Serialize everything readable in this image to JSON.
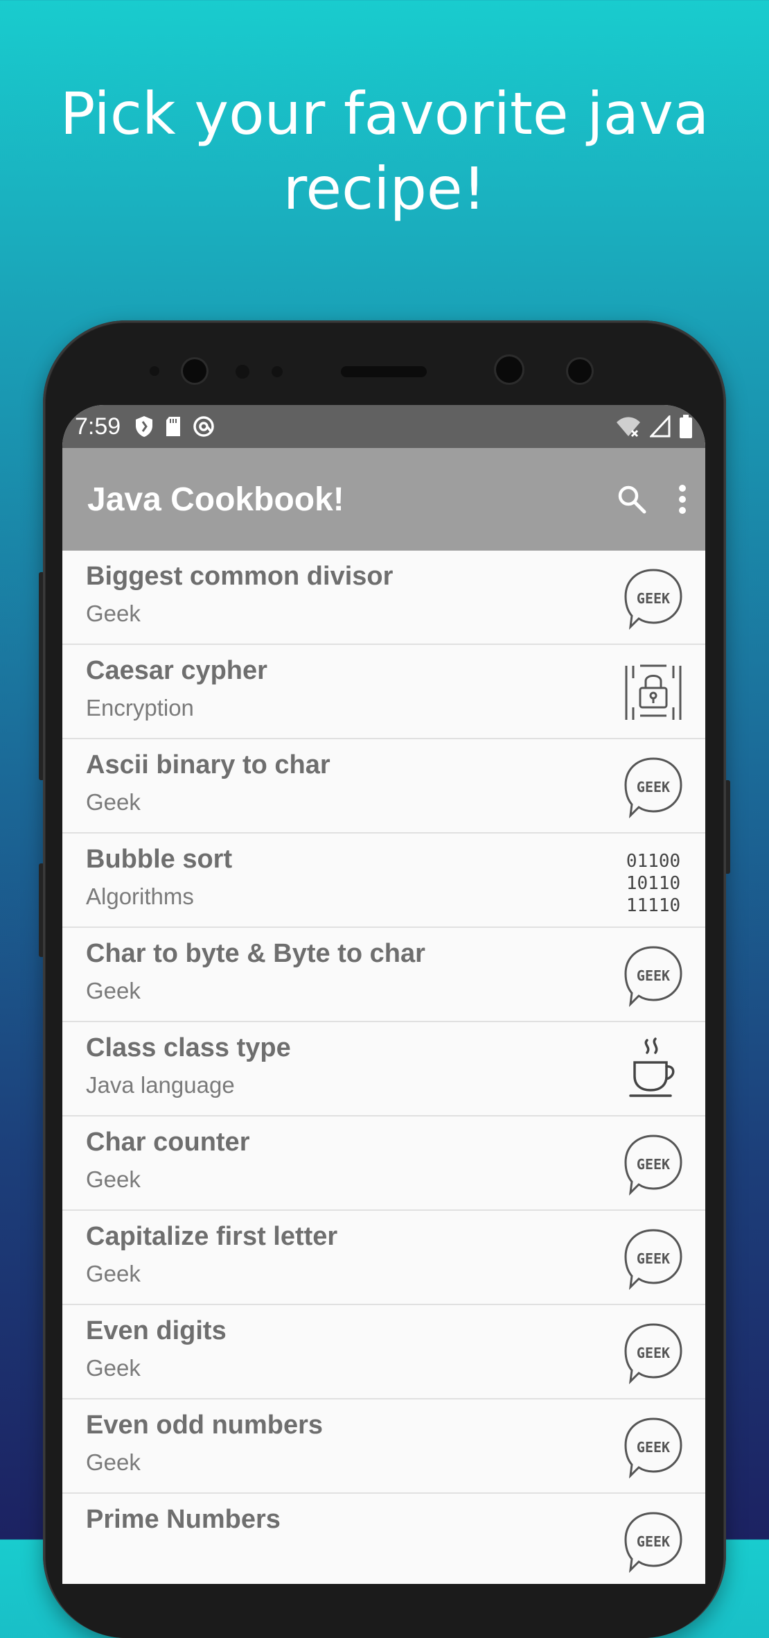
{
  "headline": {
    "line1": "Pick your favorite java",
    "line2": "recipe!"
  },
  "status_bar": {
    "time": "7:59",
    "left_icons": [
      "shield-icon",
      "sd-card-icon",
      "at-sign-icon"
    ],
    "right_icons": [
      "wifi-off-icon",
      "signal-icon",
      "battery-icon"
    ]
  },
  "app_bar": {
    "title": "Java Cookbook!",
    "actions": [
      "search-icon",
      "more-vert-icon"
    ],
    "background": "#9e9e9e"
  },
  "recipes": [
    {
      "title": "Biggest common divisor",
      "category": "Geek",
      "icon": "geek-bubble-icon"
    },
    {
      "title": "Caesar cypher",
      "category": "Encryption",
      "icon": "binary-lock-icon"
    },
    {
      "title": "Ascii binary to char",
      "category": "Geek",
      "icon": "geek-bubble-icon"
    },
    {
      "title": "Bubble sort",
      "category": "Algorithms",
      "icon": "binary-digits-icon",
      "icon_text": [
        "01100",
        "10110",
        "11110"
      ]
    },
    {
      "title": "Char to byte & Byte to char",
      "category": "Geek",
      "icon": "geek-bubble-icon"
    },
    {
      "title": "Class class type",
      "category": "Java language",
      "icon": "coffee-cup-icon"
    },
    {
      "title": "Char counter",
      "category": "Geek",
      "icon": "geek-bubble-icon"
    },
    {
      "title": "Capitalize first letter",
      "category": "Geek",
      "icon": "geek-bubble-icon"
    },
    {
      "title": "Even digits",
      "category": "Geek",
      "icon": "geek-bubble-icon"
    },
    {
      "title": "Even odd numbers",
      "category": "Geek",
      "icon": "geek-bubble-icon"
    },
    {
      "title": "Prime Numbers",
      "category": "",
      "icon": "geek-bubble-icon"
    }
  ],
  "geek_bubble_text": "GEEK",
  "colors": {
    "gradient_top": "#19ccce",
    "gradient_bottom": "#1c2262",
    "status_bar": "#616161",
    "list_background": "#fafafa",
    "item_title": "#6e6e6e"
  }
}
